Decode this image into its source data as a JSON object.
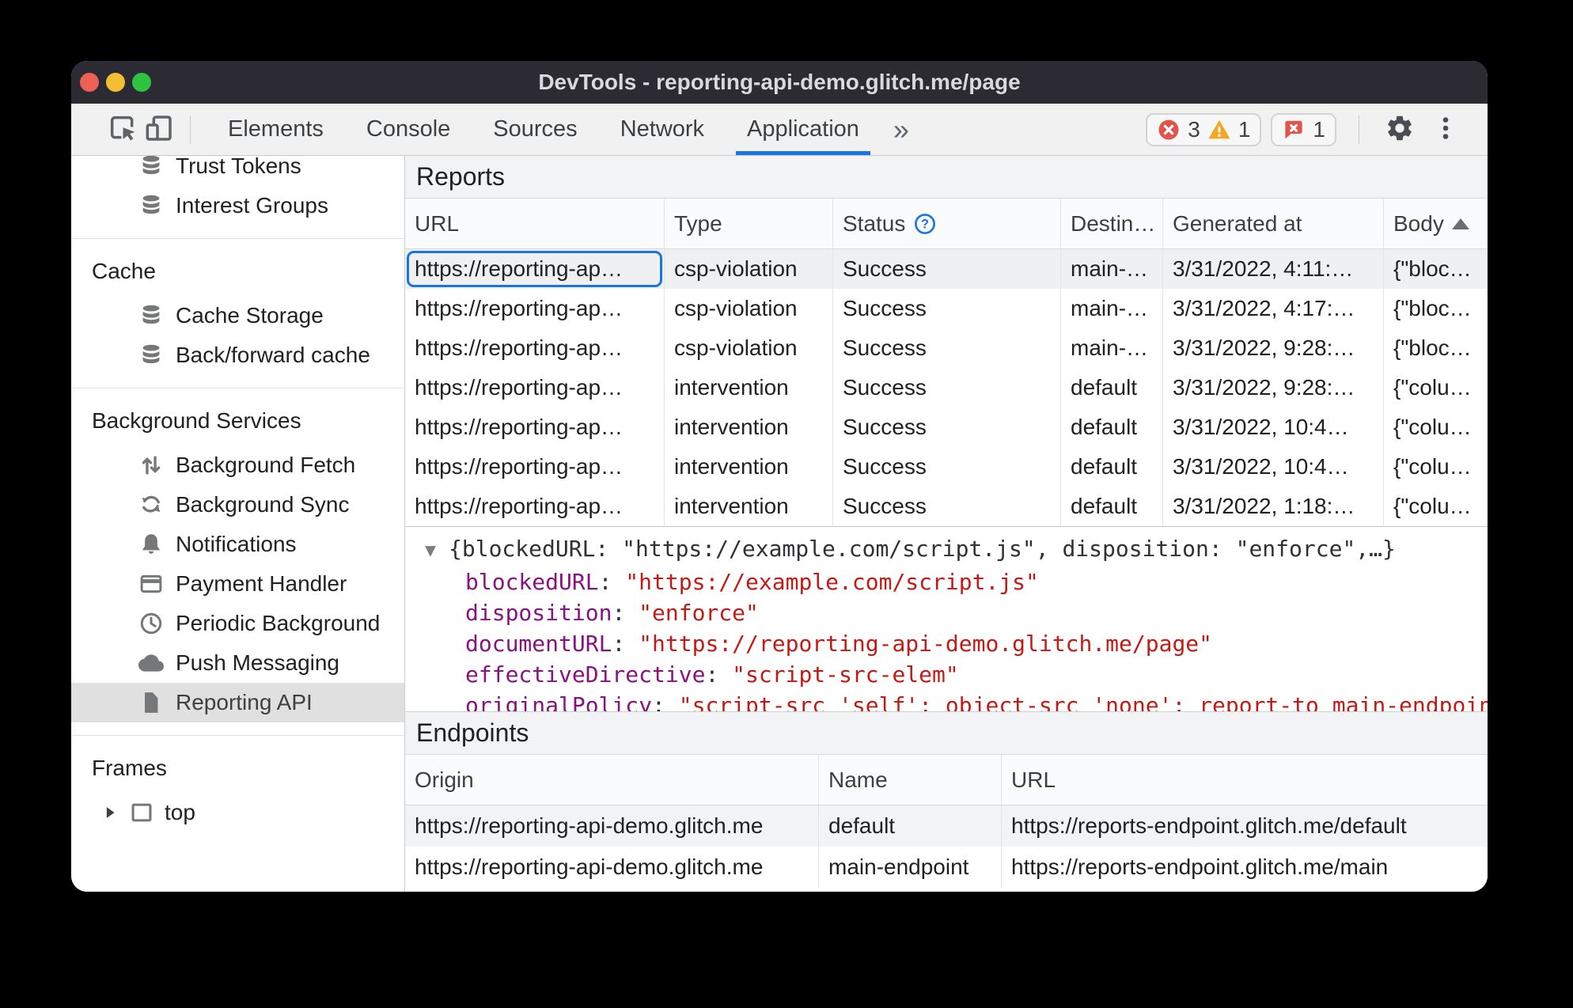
{
  "colors": {
    "accent_blue": "#1a73e8",
    "error_red": "#e1544d",
    "warning_amber": "#f5a623",
    "titlebar": "#2c2b33",
    "toolbar_bg": "#f1f1f2",
    "section_header_bg": "#f1f3f4",
    "selected_row_bg": "#eef0f2",
    "sidebar_selected_bg": "#e0e0e0",
    "json_key": "#881280",
    "json_value": "#c41a16",
    "traffic_red": "#ee5f55",
    "traffic_yellow": "#f5bd34",
    "traffic_green": "#2fc141"
  },
  "window": {
    "title": "DevTools - reporting-api-demo.glitch.me/page"
  },
  "toolbar": {
    "tabs": [
      {
        "label": "Elements"
      },
      {
        "label": "Console"
      },
      {
        "label": "Sources"
      },
      {
        "label": "Network"
      },
      {
        "label": "Application",
        "selected": true
      }
    ],
    "more_tabs_label": "»",
    "badges": {
      "error_count": "3",
      "warning_count": "1",
      "issue_count": "1"
    }
  },
  "sidebar": {
    "sections": [
      {
        "items": [
          {
            "icon": "database-icon",
            "label": "Trust Tokens"
          },
          {
            "icon": "database-icon",
            "label": "Interest Groups"
          }
        ]
      },
      {
        "header": "Cache",
        "items": [
          {
            "icon": "database-icon",
            "label": "Cache Storage"
          },
          {
            "icon": "database-icon",
            "label": "Back/forward cache"
          }
        ]
      },
      {
        "header": "Background Services",
        "items": [
          {
            "icon": "background-fetch-icon",
            "label": "Background Fetch"
          },
          {
            "icon": "background-sync-icon",
            "label": "Background Sync"
          },
          {
            "icon": "bell-icon",
            "label": "Notifications"
          },
          {
            "icon": "payment-card-icon",
            "label": "Payment Handler"
          },
          {
            "icon": "clock-icon",
            "label": "Periodic Background"
          },
          {
            "icon": "cloud-icon",
            "label": "Push Messaging"
          },
          {
            "icon": "document-icon",
            "label": "Reporting API",
            "selected": true
          }
        ]
      },
      {
        "header": "Frames",
        "items": [
          {
            "icon": "frame-icon",
            "label": "top",
            "disclosure": true
          }
        ]
      }
    ]
  },
  "reports": {
    "section_title": "Reports",
    "columns": [
      {
        "label": "URL",
        "key": "url"
      },
      {
        "label": "Type",
        "key": "type"
      },
      {
        "label": "Status",
        "key": "status",
        "help_icon": true
      },
      {
        "label": "Destin…",
        "key": "destination"
      },
      {
        "label": "Generated at",
        "key": "generated_at"
      },
      {
        "label": "Body",
        "key": "body",
        "sorted": "asc"
      }
    ],
    "rows": [
      {
        "url": "https://reporting-ap…",
        "type": "csp-violation",
        "status": "Success",
        "destination": "main-…",
        "generated_at": "3/31/2022, 4:11:…",
        "body": "{\"bloc…",
        "selected": true
      },
      {
        "url": "https://reporting-ap…",
        "type": "csp-violation",
        "status": "Success",
        "destination": "main-…",
        "generated_at": "3/31/2022, 4:17:…",
        "body": "{\"bloc…"
      },
      {
        "url": "https://reporting-ap…",
        "type": "csp-violation",
        "status": "Success",
        "destination": "main-…",
        "generated_at": "3/31/2022, 9:28:…",
        "body": "{\"bloc…"
      },
      {
        "url": "https://reporting-ap…",
        "type": "intervention",
        "status": "Success",
        "destination": "default",
        "generated_at": "3/31/2022, 9:28:…",
        "body": "{\"colu…"
      },
      {
        "url": "https://reporting-ap…",
        "type": "intervention",
        "status": "Success",
        "destination": "default",
        "generated_at": "3/31/2022, 10:4…",
        "body": "{\"colu…"
      },
      {
        "url": "https://reporting-ap…",
        "type": "intervention",
        "status": "Success",
        "destination": "default",
        "generated_at": "3/31/2022, 10:4…",
        "body": "{\"colu…"
      },
      {
        "url": "https://reporting-ap…",
        "type": "intervention",
        "status": "Success",
        "destination": "default",
        "generated_at": "3/31/2022, 1:18:…",
        "body": "{\"colu…"
      }
    ]
  },
  "report_detail": {
    "preview": "{blockedURL: \"https://example.com/script.js\", disposition: \"enforce\",…}",
    "entries": [
      {
        "key": "blockedURL",
        "value": "\"https://example.com/script.js\""
      },
      {
        "key": "disposition",
        "value": "\"enforce\""
      },
      {
        "key": "documentURL",
        "value": "\"https://reporting-api-demo.glitch.me/page\""
      },
      {
        "key": "effectiveDirective",
        "value": "\"script-src-elem\""
      },
      {
        "key": "originalPolicy",
        "value": "\"script-src 'self'; object-src 'none'; report-to main-endpoint;\"",
        "clipped": true
      }
    ]
  },
  "endpoints": {
    "section_title": "Endpoints",
    "columns": [
      {
        "label": "Origin",
        "key": "origin"
      },
      {
        "label": "Name",
        "key": "name"
      },
      {
        "label": "URL",
        "key": "url"
      }
    ],
    "rows": [
      {
        "origin": "https://reporting-api-demo.glitch.me",
        "name": "default",
        "url": "https://reports-endpoint.glitch.me/default"
      },
      {
        "origin": "https://reporting-api-demo.glitch.me",
        "name": "main-endpoint",
        "url": "https://reports-endpoint.glitch.me/main"
      }
    ]
  }
}
